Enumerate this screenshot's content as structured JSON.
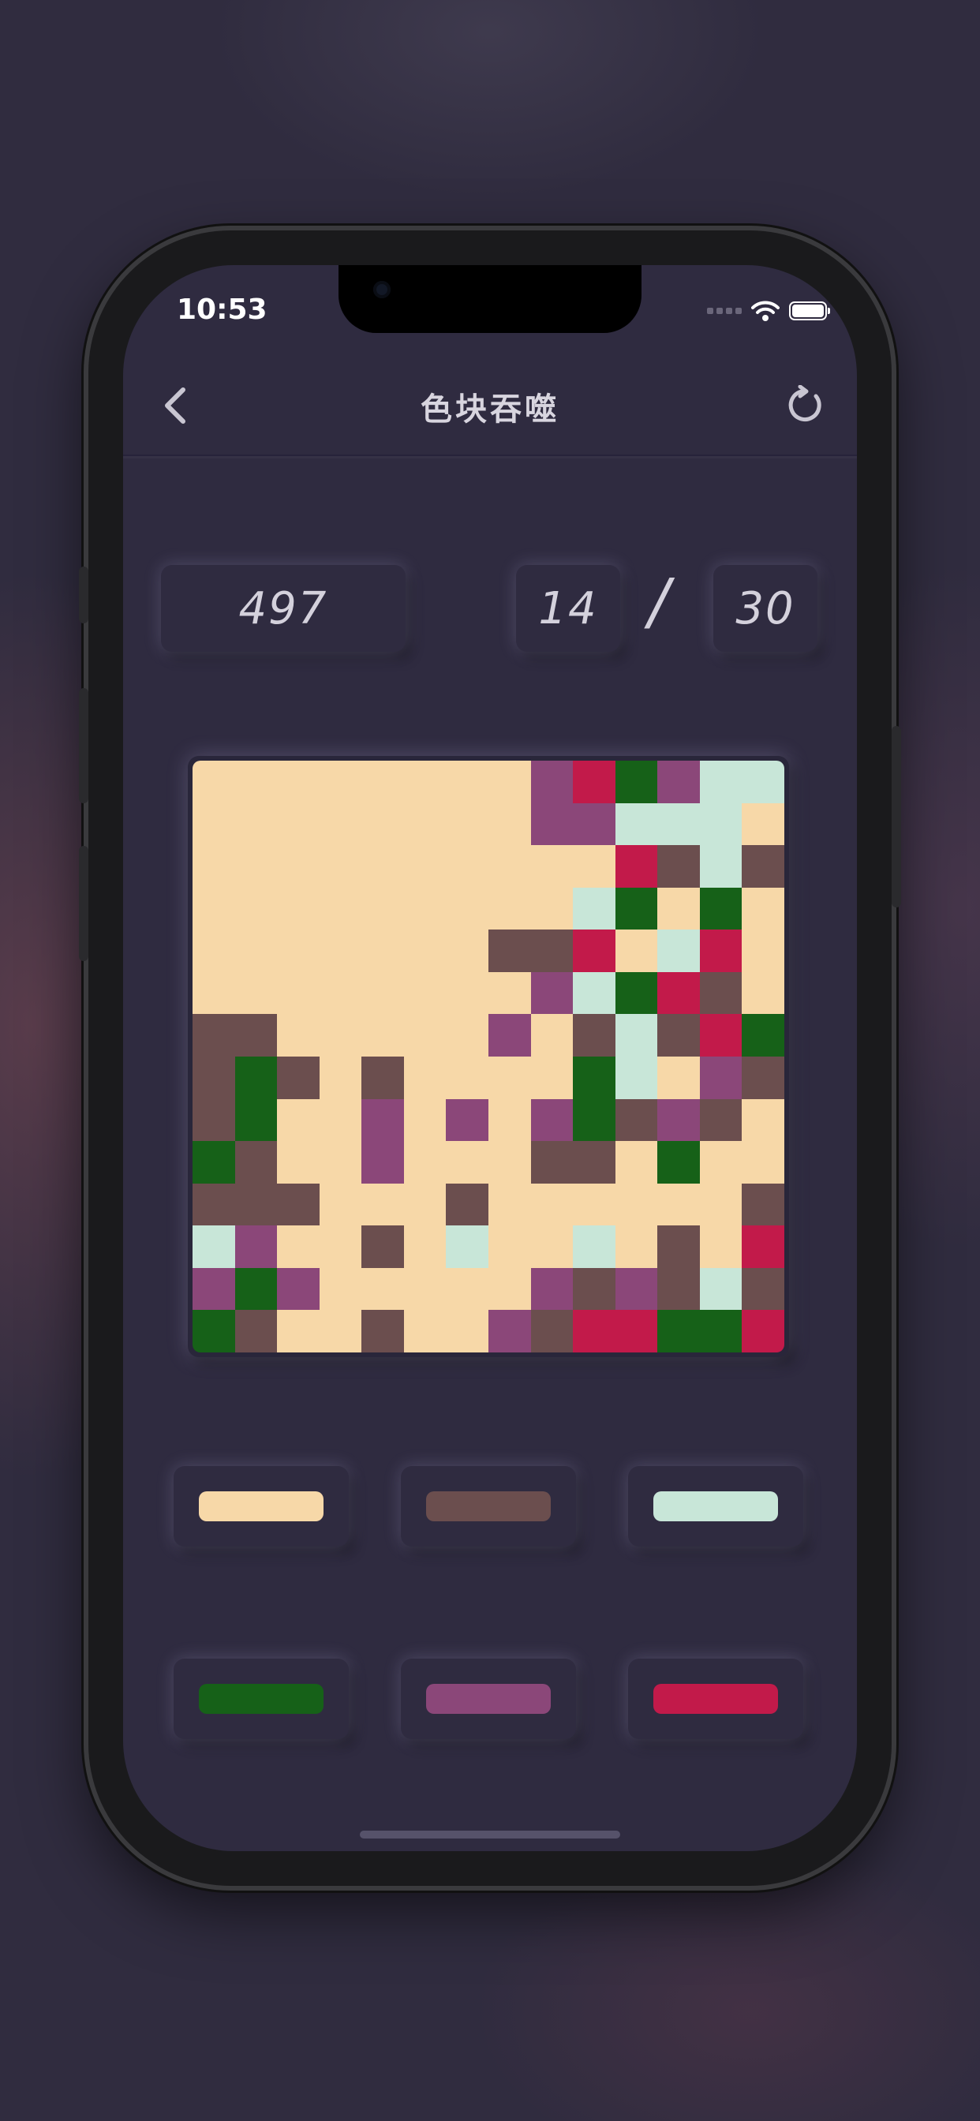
{
  "status": {
    "time": "10:53"
  },
  "nav": {
    "title": "色块吞噬",
    "back_icon": "chevron-left-icon",
    "refresh_icon": "refresh-icon"
  },
  "stats": {
    "score": "497",
    "moves_used": "14",
    "separator": "/",
    "moves_total": "30"
  },
  "palette": {
    "C": "#f7d8a8",
    "B": "#6b4e4e",
    "L": "#c8e6d8",
    "G": "#166118",
    "P": "#8b4779",
    "R": "#c21a4a"
  },
  "board": [
    "CCCCCCCCPRGPLL",
    "CCCCCCCCPPLLLC",
    "CCCCCCCCCCRBLB",
    "CCCCCCCCCLGCGC",
    "CCCCCCCBBRCLRC",
    "CCCCCCCCPLGRBC",
    "BBCCCCCPCBLBRG",
    "BGBCBCCCCGLCPB",
    "BGCCPCPCPGBPBC",
    "GBCCPCCCBBCGCC",
    "BBBCCCBCCCCCCB",
    "LPCCBCLCCLCBCR",
    "PGPCCCCCPBPBLB",
    "GBCCBCCPBRRGGR"
  ],
  "color_buttons": [
    {
      "name": "cream",
      "color": "#f7d8a8"
    },
    {
      "name": "brown",
      "color": "#6b4e4e"
    },
    {
      "name": "mint",
      "color": "#c8e6d8"
    },
    {
      "name": "green",
      "color": "#166118"
    },
    {
      "name": "purple",
      "color": "#8b4779"
    },
    {
      "name": "red",
      "color": "#c21a4a"
    }
  ]
}
